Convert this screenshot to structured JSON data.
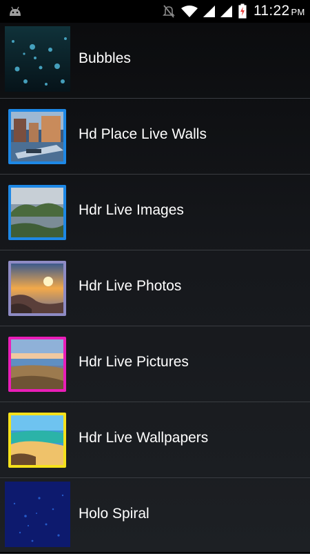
{
  "status_bar": {
    "time": "11:22",
    "ampm": "PM",
    "icons": [
      "android-icon",
      "mute-icon",
      "wifi-icon",
      "signal-icon",
      "signal-icon",
      "battery-charging-icon"
    ]
  },
  "wallpapers": [
    {
      "label": "Bubbles",
      "icon": "bubbles-thumbnail",
      "frame": "none"
    },
    {
      "label": "Hd Place Live Walls",
      "icon": "canal-city-thumbnail",
      "frame": "#1e88e5"
    },
    {
      "label": "Hdr Live Images",
      "icon": "lake-landscape-thumbnail",
      "frame": "#1e88e5"
    },
    {
      "label": "Hdr Live Photos",
      "icon": "sunset-rocks-thumbnail",
      "frame": "#8e8bc4"
    },
    {
      "label": "Hdr Live Pictures",
      "icon": "desert-lake-thumbnail",
      "frame": "#e91eb8"
    },
    {
      "label": "Hdr Live Wallpapers",
      "icon": "beach-thumbnail",
      "frame": "#f5e11b"
    },
    {
      "label": "Holo Spiral",
      "icon": "holo-spiral-thumbnail",
      "frame": "none"
    }
  ]
}
